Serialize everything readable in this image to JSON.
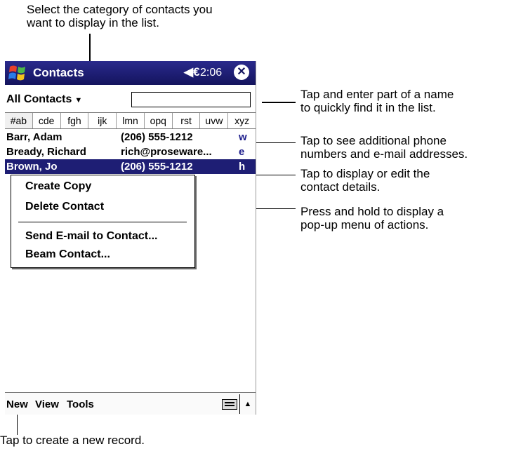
{
  "callouts": {
    "top": [
      "Select the category of contacts you",
      "want to display in the list."
    ],
    "find": [
      "Tap and enter part of a name",
      "to quickly find it in the list."
    ],
    "phone": [
      "Tap to see additional phone",
      "numbers and e-mail addresses."
    ],
    "details": [
      "Tap to display or edit the",
      "contact details."
    ],
    "popup": [
      "Press and hold to display a",
      "pop-up menu of actions."
    ],
    "new": "Tap to create a new record."
  },
  "titlebar": {
    "title": "Contacts",
    "speaker": "◀€",
    "time": "2:06",
    "close_symbol": "✕",
    "bg_color": "#1e1e74"
  },
  "category": {
    "label": "All Contacts",
    "arrow": "▼"
  },
  "search": {
    "value": "",
    "placeholder": ""
  },
  "abc_tabs": [
    "#ab",
    "cde",
    "fgh",
    "ijk",
    "lmn",
    "opq",
    "rst",
    "uvw",
    "xyz"
  ],
  "contacts": [
    {
      "name": "Barr, Adam",
      "value": "(206) 555-1212",
      "type": "w"
    },
    {
      "name": "Bready, Richard",
      "value": "rich@proseware...",
      "type": "e"
    },
    {
      "name": "Brown, Jo",
      "value": "(206) 555-1212",
      "type": "h",
      "selected": true
    }
  ],
  "popup_menu": {
    "items": [
      "Create Copy",
      "Delete Contact",
      "Send E-mail to Contact...",
      "Beam Contact..."
    ]
  },
  "bottom_menu": {
    "new": "New",
    "view": "View",
    "tools": "Tools",
    "arrow": "▲"
  }
}
